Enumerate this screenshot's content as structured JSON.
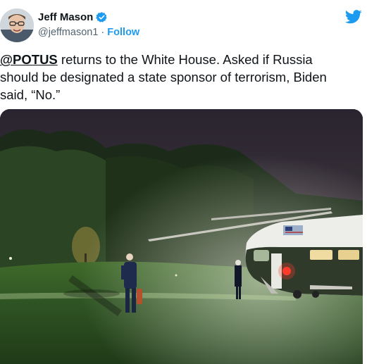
{
  "author": {
    "display_name": "Jeff Mason",
    "handle": "@jeffmason1",
    "separator": "·",
    "follow_label": "Follow",
    "verified": true
  },
  "tweet": {
    "mention": "@POTUS",
    "line1_rest": " returns to the White House. Asked if Russia",
    "line2": "should be designated a state sponsor of terrorism, Biden",
    "line3": "said, “No.”"
  },
  "media": {
    "description_icon": "photo",
    "helicopter_flag": "us-flag"
  },
  "colors": {
    "accent": "#1d9bf0",
    "text": "#0f1419",
    "muted": "#536471"
  }
}
